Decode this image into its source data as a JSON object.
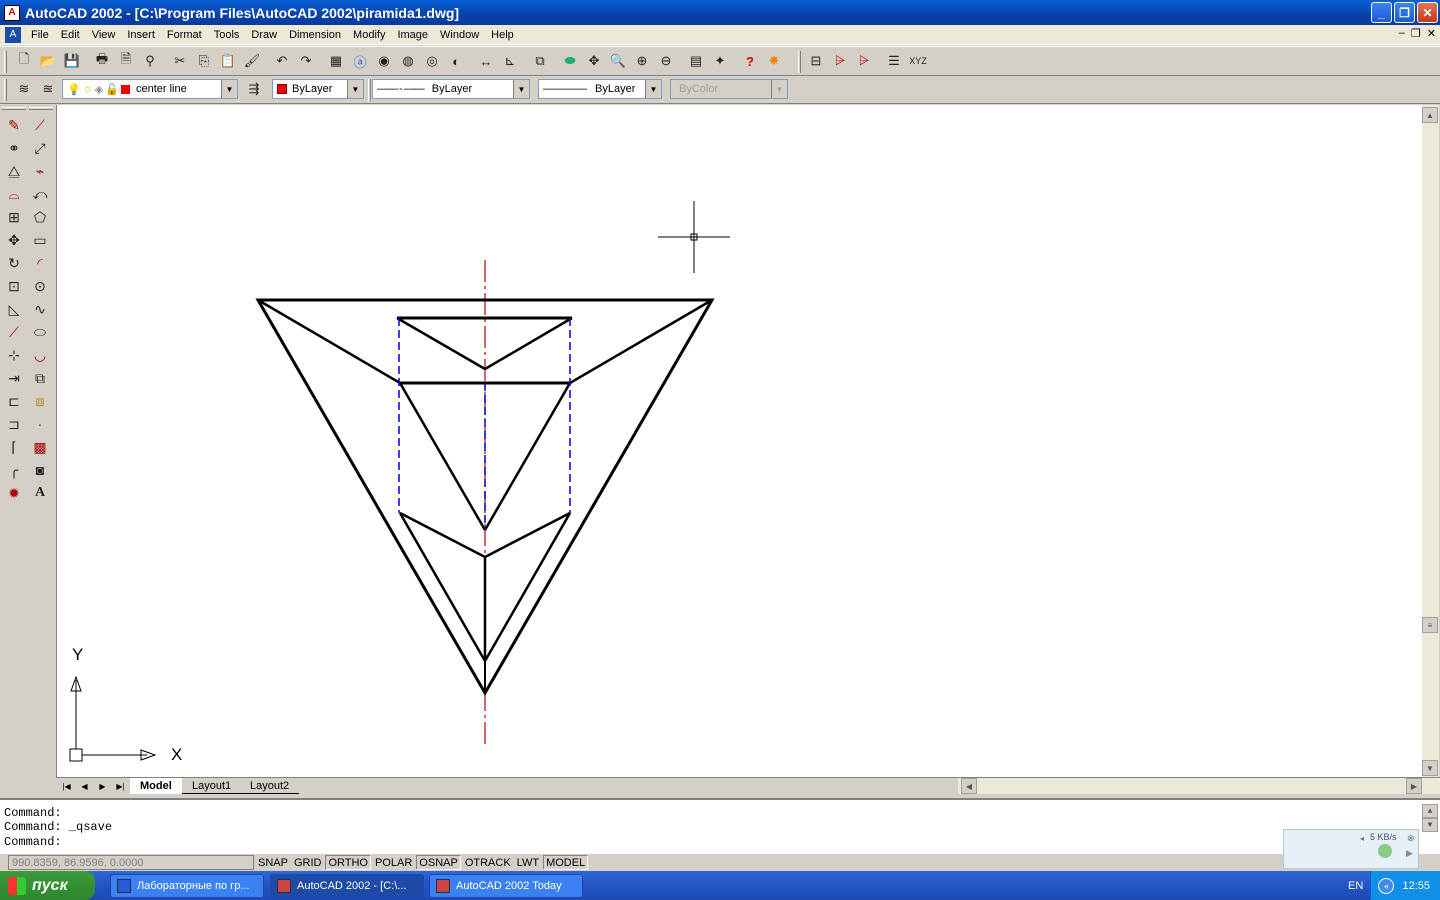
{
  "window": {
    "title": "AutoCAD 2002 - [C:\\Program Files\\AutoCAD 2002\\piramida1.dwg]"
  },
  "menu": [
    "File",
    "Edit",
    "View",
    "Insert",
    "Format",
    "Tools",
    "Draw",
    "Dimension",
    "Modify",
    "Image",
    "Window",
    "Help"
  ],
  "properties": {
    "layer": "center line",
    "color": "ByLayer",
    "linetype": "ByLayer",
    "lineweight": "ByLayer",
    "plotstyle": "ByColor"
  },
  "ucs": {
    "x_label": "X",
    "y_label": "Y"
  },
  "layout_tabs": [
    "Model",
    "Layout1",
    "Layout2"
  ],
  "command": {
    "lines": [
      "Command:",
      "Command:  _qsave",
      "Command:"
    ]
  },
  "status": {
    "coords": "990.8359, 86.9596, 0.0000",
    "buttons": [
      "SNAP",
      "GRID",
      "ORTHO",
      "POLAR",
      "OSNAP",
      "OTRACK",
      "LWT",
      "MODEL"
    ],
    "active": [
      "ORTHO",
      "OSNAP",
      "MODEL"
    ]
  },
  "network": {
    "speed": "5 KB/s"
  },
  "taskbar": {
    "start": "пуск",
    "tasks": [
      "Лабораторные по гр...",
      "AutoCAD 2002 - [C:\\...",
      "AutoCAD 2002 Today"
    ],
    "lang": "EN",
    "clock": "12:55"
  },
  "colors": {
    "drawing": "#000000",
    "hidden_line": "#0000cc",
    "center_line": "#c00000",
    "title_blue": "#0a5fd8"
  }
}
